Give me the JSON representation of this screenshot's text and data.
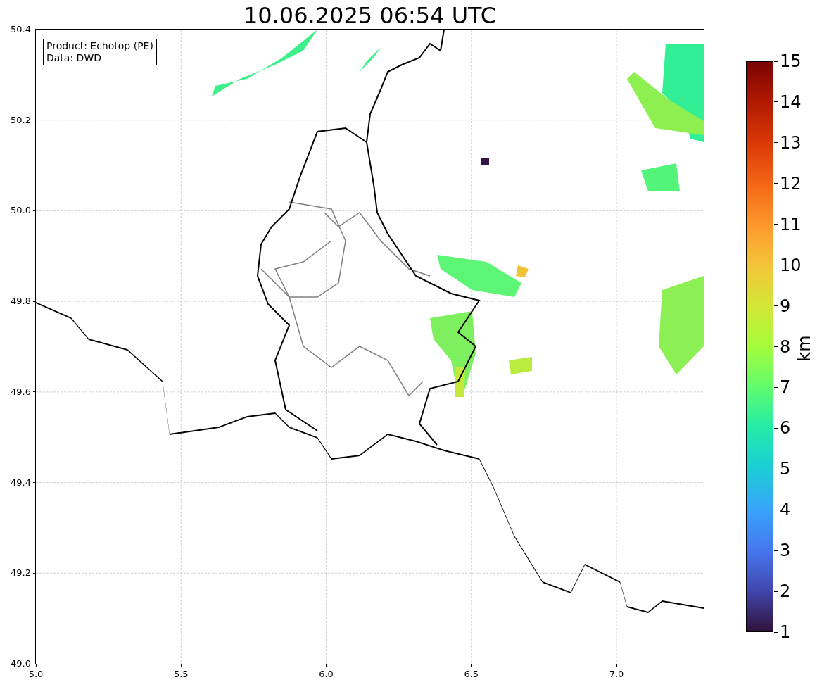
{
  "title": "10.06.2025 06:54 UTC",
  "info_box": [
    "Product: Echotop (PE)",
    "Data: DWD"
  ],
  "x_axis": {
    "ticks": [
      "5.0",
      "5.5",
      "6.0",
      "6.5",
      "7.0"
    ]
  },
  "y_axis": {
    "ticks": [
      "50.4",
      "50.2",
      "50.0",
      "49.8",
      "49.6",
      "49.4",
      "49.2",
      "49.0"
    ]
  },
  "colorbar": {
    "label": "km",
    "ticks": [
      "15",
      "14",
      "13",
      "12",
      "11",
      "10",
      "9",
      "8",
      "7",
      "6",
      "5",
      "4",
      "3",
      "2",
      "1"
    ]
  }
}
